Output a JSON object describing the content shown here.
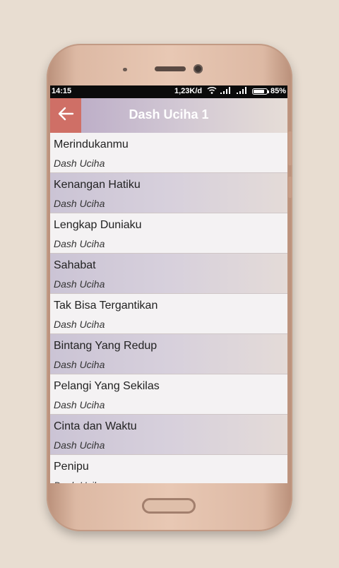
{
  "status_bar": {
    "time": "14:15",
    "network_speed": "1,23K/d",
    "battery_percent": "85%",
    "battery_level": 0.85
  },
  "app_bar": {
    "title": "Dash Uciha 1",
    "back_icon": "arrow-left-icon"
  },
  "songs": [
    {
      "title": "Merindukanmu",
      "artist": "Dash Uciha"
    },
    {
      "title": "Kenangan Hatiku",
      "artist": "Dash Uciha"
    },
    {
      "title": "Lengkap Duniaku",
      "artist": "Dash Uciha"
    },
    {
      "title": "Sahabat",
      "artist": "Dash Uciha"
    },
    {
      "title": "Tak Bisa Tergantikan",
      "artist": "Dash Uciha"
    },
    {
      "title": "Bintang Yang Redup",
      "artist": "Dash Uciha"
    },
    {
      "title": "Pelangi Yang Sekilas",
      "artist": "Dash Uciha"
    },
    {
      "title": "Cinta dan Waktu",
      "artist": "Dash Uciha"
    },
    {
      "title": "Penipu",
      "artist": "Dash Uciha"
    }
  ],
  "colors": {
    "back_button": "#cf6f66",
    "app_bar_start": "#b7a7c4",
    "app_bar_end": "#e6ddd7",
    "phone_body": "#e8c8b4",
    "background": "#e8ddd1"
  }
}
